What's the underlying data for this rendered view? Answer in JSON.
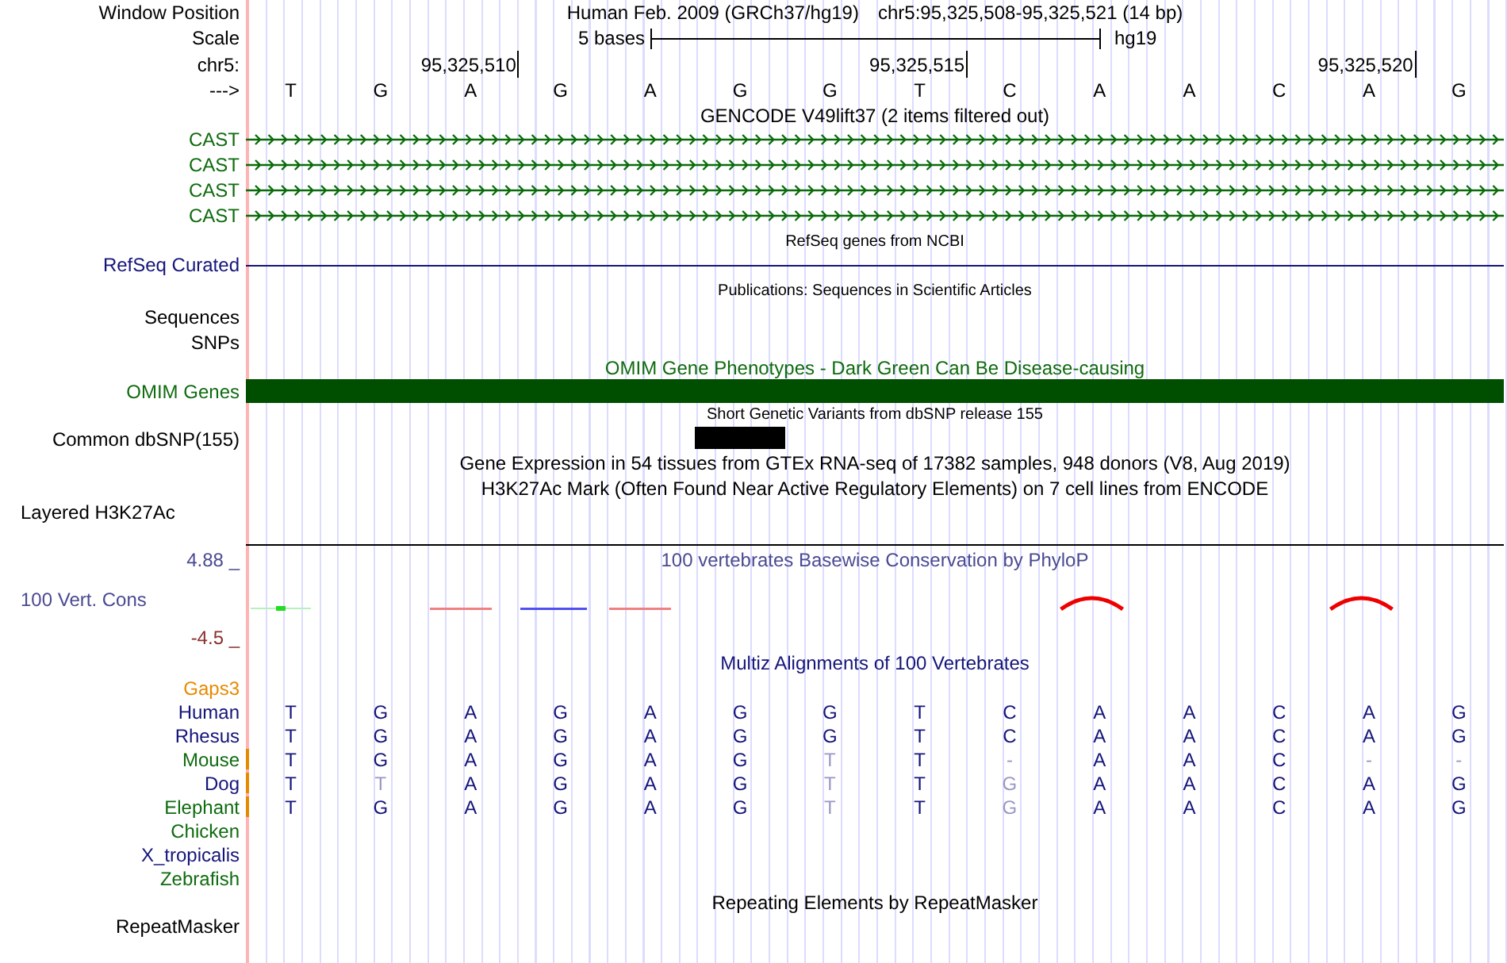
{
  "header": {
    "label": "Window Position",
    "title": "Human Feb. 2009 (GRCh37/hg19)",
    "position": "chr5:95,325,508-95,325,521 (14 bp)"
  },
  "scale": {
    "label": "Scale",
    "length": "5 bases",
    "assembly": "hg19"
  },
  "ruler": {
    "label": "chr5:",
    "strand": "--->"
  },
  "sequence": [
    {
      "letter": "T",
      "snp": false
    },
    {
      "letter": "G",
      "snp": false
    },
    {
      "letter": "A",
      "tick": "95,325,510",
      "snp": false
    },
    {
      "letter": "G",
      "snp": false
    },
    {
      "letter": "A",
      "snp": false
    },
    {
      "letter": "G",
      "snp": true
    },
    {
      "letter": "G",
      "snp": false
    },
    {
      "letter": "T",
      "tick": "95,325,515",
      "snp": false
    },
    {
      "letter": "C",
      "snp": false
    },
    {
      "letter": "A",
      "snp": false
    },
    {
      "letter": "A",
      "snp": false
    },
    {
      "letter": "C",
      "snp": false
    },
    {
      "letter": "A",
      "tick": "95,325,520",
      "snp": false
    },
    {
      "letter": "G",
      "snp": false
    }
  ],
  "gencode": {
    "title": "GENCODE V49lift37 (2 items filtered out)",
    "transcripts": [
      {
        "label": "CAST"
      },
      {
        "label": "CAST"
      },
      {
        "label": "CAST"
      },
      {
        "label": "CAST"
      }
    ]
  },
  "refseq": {
    "title": "RefSeq genes from NCBI",
    "label": "RefSeq Curated"
  },
  "publications": {
    "title": "Publications: Sequences in Scientific Articles",
    "label": "Sequences"
  },
  "snps": {
    "label": "SNPs"
  },
  "omim": {
    "title": "OMIM Gene Phenotypes - Dark Green Can Be Disease-causing",
    "label": "OMIM Genes"
  },
  "dbsnp": {
    "title": "Short Genetic Variants from dbSNP release 155",
    "label": "Common dbSNP(155)"
  },
  "gtex": {
    "title": "Gene Expression in 54 tissues from GTEx RNA-seq of 17382 samples, 948 donors (V8, Aug 2019)"
  },
  "h3k27ac": {
    "title": "H3K27Ac Mark (Often Found Near Active Regulatory Elements) on 7 cell lines from ENCODE",
    "label": "Layered H3K27Ac"
  },
  "conservation": {
    "title": "100 vertebrates Basewise Conservation by PhyloP",
    "label": "100 Vert. Cons",
    "max": "4.88 _",
    "min": "-4.5 _"
  },
  "multiz": {
    "title": "Multiz Alignments of 100 Vertebrates",
    "gaps_label": "Gaps3",
    "species": [
      {
        "name": "Human",
        "color": "#14147a",
        "gap": false,
        "bases": [
          {
            "letter": "T",
            "dim": false
          },
          {
            "letter": "G",
            "dim": false
          },
          {
            "letter": "A",
            "dim": false
          },
          {
            "letter": "G",
            "dim": false
          },
          {
            "letter": "A",
            "dim": false
          },
          {
            "letter": "G",
            "dim": false
          },
          {
            "letter": "G",
            "dim": false
          },
          {
            "letter": "T",
            "dim": false
          },
          {
            "letter": "C",
            "dim": false
          },
          {
            "letter": "A",
            "dim": false
          },
          {
            "letter": "A",
            "dim": false
          },
          {
            "letter": "C",
            "dim": false
          },
          {
            "letter": "A",
            "dim": false
          },
          {
            "letter": "G",
            "dim": false
          }
        ]
      },
      {
        "name": "Rhesus",
        "color": "#14147a",
        "gap": false,
        "bases": [
          {
            "letter": "T",
            "dim": false
          },
          {
            "letter": "G",
            "dim": false
          },
          {
            "letter": "A",
            "dim": false
          },
          {
            "letter": "G",
            "dim": false
          },
          {
            "letter": "A",
            "dim": false
          },
          {
            "letter": "G",
            "dim": false
          },
          {
            "letter": "G",
            "dim": false
          },
          {
            "letter": "T",
            "dim": false
          },
          {
            "letter": "C",
            "dim": false
          },
          {
            "letter": "A",
            "dim": false
          },
          {
            "letter": "A",
            "dim": false
          },
          {
            "letter": "C",
            "dim": false
          },
          {
            "letter": "A",
            "dim": false
          },
          {
            "letter": "G",
            "dim": false
          }
        ]
      },
      {
        "name": "Mouse",
        "color": "#0f6b0f",
        "gap": true,
        "bases": [
          {
            "letter": "T",
            "dim": false
          },
          {
            "letter": "G",
            "dim": false
          },
          {
            "letter": "A",
            "dim": false
          },
          {
            "letter": "G",
            "dim": false
          },
          {
            "letter": "A",
            "dim": false
          },
          {
            "letter": "G",
            "dim": false
          },
          {
            "letter": "T",
            "dim": true
          },
          {
            "letter": "T",
            "dim": false
          },
          {
            "letter": "-",
            "dim": true
          },
          {
            "letter": "A",
            "dim": false
          },
          {
            "letter": "A",
            "dim": false
          },
          {
            "letter": "C",
            "dim": false
          },
          {
            "letter": "-",
            "dim": true
          },
          {
            "letter": "-",
            "dim": true
          }
        ]
      },
      {
        "name": "Dog",
        "color": "#14147a",
        "gap": true,
        "bases": [
          {
            "letter": "T",
            "dim": false
          },
          {
            "letter": "T",
            "dim": true
          },
          {
            "letter": "A",
            "dim": false
          },
          {
            "letter": "G",
            "dim": false
          },
          {
            "letter": "A",
            "dim": false
          },
          {
            "letter": "G",
            "dim": false
          },
          {
            "letter": "T",
            "dim": true
          },
          {
            "letter": "T",
            "dim": false
          },
          {
            "letter": "G",
            "dim": true
          },
          {
            "letter": "A",
            "dim": false
          },
          {
            "letter": "A",
            "dim": false
          },
          {
            "letter": "C",
            "dim": false
          },
          {
            "letter": "A",
            "dim": false
          },
          {
            "letter": "G",
            "dim": false
          }
        ]
      },
      {
        "name": "Elephant",
        "color": "#0f6b0f",
        "gap": true,
        "bases": [
          {
            "letter": "T",
            "dim": false
          },
          {
            "letter": "G",
            "dim": false
          },
          {
            "letter": "A",
            "dim": false
          },
          {
            "letter": "G",
            "dim": false
          },
          {
            "letter": "A",
            "dim": false
          },
          {
            "letter": "G",
            "dim": false
          },
          {
            "letter": "T",
            "dim": true
          },
          {
            "letter": "T",
            "dim": false
          },
          {
            "letter": "G",
            "dim": true
          },
          {
            "letter": "A",
            "dim": false
          },
          {
            "letter": "A",
            "dim": false
          },
          {
            "letter": "C",
            "dim": false
          },
          {
            "letter": "A",
            "dim": false
          },
          {
            "letter": "G",
            "dim": false
          }
        ]
      },
      {
        "name": "Chicken",
        "color": "#0f6b0f",
        "gap": false
      },
      {
        "name": "X_tropicalis",
        "color": "#14147a",
        "gap": false
      },
      {
        "name": "Zebrafish",
        "color": "#0f6b0f",
        "gap": false
      }
    ]
  },
  "repeatmasker": {
    "title": "Repeating Elements by RepeatMasker",
    "label": "RepeatMasker"
  }
}
